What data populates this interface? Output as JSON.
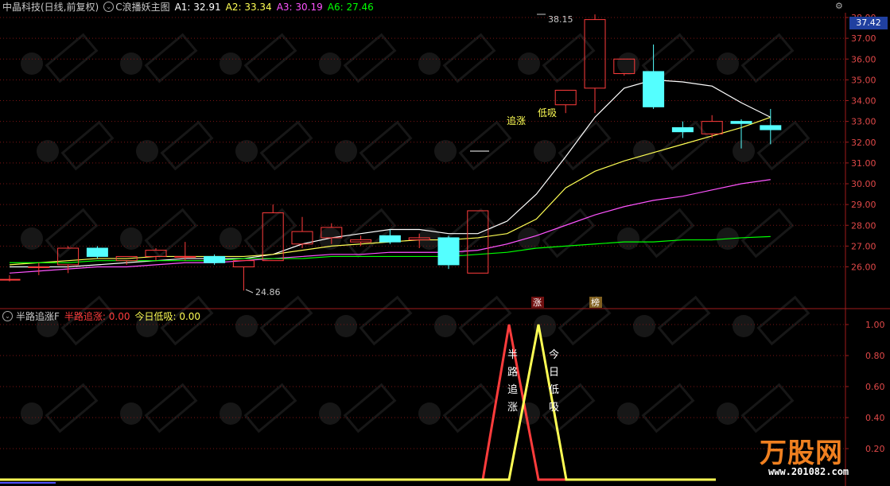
{
  "header": {
    "stock": "中晶科技(日线,前复权)",
    "indicator": "C浪播妖主图",
    "a1": "A1: 32.91",
    "a2": "A2: 33.34",
    "a3": "A3: 30.19",
    "a6": "A6: 27.46"
  },
  "sub_header": {
    "name": "半路追涨F",
    "v1": "半路追涨: 0.00",
    "v2": "今日低吸: 0.00"
  },
  "current_price": "37.42",
  "annotations": {
    "high": "38.15",
    "low": "24.86",
    "zhuizhang": "追涨",
    "dixi": "低吸",
    "tag_zhang": "涨",
    "tag_bang": "榜",
    "sub_label1": "半路追涨",
    "sub_label2": "今日低吸"
  },
  "watermark": {
    "logo": "万股网",
    "url": "www.201082.com"
  },
  "colors": {
    "up": "#ff3c3c",
    "down": "#54ffff",
    "a1": "#ffffff",
    "a2": "#ffff54",
    "a3": "#ff54ff",
    "a6": "#00ff00",
    "grid": "#7a1414"
  },
  "chart_data": [
    {
      "type": "candlestick",
      "title": "C浪播妖主图",
      "ylim": [
        25.3,
        38.5
      ],
      "yticks": [
        "38.00",
        "37.00",
        "36.00",
        "35.00",
        "34.00",
        "33.00",
        "32.00",
        "31.00",
        "30.00",
        "29.00",
        "28.00",
        "27.00",
        "26.00"
      ],
      "ohlc": [
        [
          25.4,
          25.6,
          25.3,
          25.4
        ],
        [
          26.0,
          26.2,
          25.6,
          26.0
        ],
        [
          26.1,
          27.0,
          25.7,
          26.9
        ],
        [
          26.9,
          27.0,
          26.4,
          26.5
        ],
        [
          26.3,
          26.5,
          26.1,
          26.5
        ],
        [
          26.5,
          26.9,
          26.3,
          26.8
        ],
        [
          26.5,
          27.2,
          26.3,
          26.5
        ],
        [
          26.5,
          26.6,
          26.1,
          26.2
        ],
        [
          26.0,
          26.3,
          24.86,
          26.3
        ],
        [
          26.3,
          29.0,
          26.3,
          28.6
        ],
        [
          27.1,
          28.4,
          26.9,
          27.7
        ],
        [
          27.4,
          28.1,
          27.1,
          27.9
        ],
        [
          27.2,
          27.5,
          27.0,
          27.3
        ],
        [
          27.5,
          27.8,
          27.1,
          27.2
        ],
        [
          27.3,
          27.6,
          26.9,
          27.4
        ],
        [
          27.4,
          27.5,
          25.9,
          26.1
        ],
        [
          25.7,
          28.7,
          25.7,
          28.7
        ],
        null,
        null,
        [
          33.8,
          34.5,
          33.4,
          34.5
        ],
        [
          34.6,
          38.15,
          33.4,
          37.9
        ],
        [
          35.3,
          36.0,
          35.2,
          36.0
        ],
        [
          35.4,
          36.7,
          33.6,
          33.7
        ],
        [
          32.7,
          33.0,
          32.2,
          32.5
        ],
        [
          32.4,
          33.3,
          32.2,
          33.0
        ],
        [
          33.0,
          33.1,
          31.7,
          32.9
        ],
        [
          32.8,
          33.6,
          31.9,
          32.6
        ]
      ],
      "series": [
        {
          "name": "A1",
          "values": [
            26.0,
            26.0,
            26.0,
            26.1,
            26.2,
            26.3,
            26.4,
            26.4,
            26.4,
            26.6,
            27.1,
            27.4,
            27.6,
            27.8,
            27.8,
            27.6,
            27.6,
            28.2,
            29.5,
            31.3,
            33.2,
            34.6,
            35.0,
            34.9,
            34.7,
            33.9,
            33.2
          ]
        },
        {
          "name": "A2",
          "values": [
            26.1,
            26.2,
            26.3,
            26.4,
            26.4,
            26.5,
            26.5,
            26.5,
            26.5,
            26.6,
            26.8,
            27.0,
            27.1,
            27.2,
            27.3,
            27.3,
            27.4,
            27.6,
            28.3,
            29.8,
            30.6,
            31.1,
            31.5,
            31.9,
            32.3,
            32.7,
            33.2
          ]
        },
        {
          "name": "A3",
          "values": [
            25.7,
            25.8,
            25.9,
            26.0,
            26.0,
            26.1,
            26.2,
            26.2,
            26.3,
            26.4,
            26.5,
            26.6,
            26.6,
            26.7,
            26.7,
            26.7,
            26.8,
            27.1,
            27.5,
            28.0,
            28.5,
            28.9,
            29.2,
            29.4,
            29.7,
            30.0,
            30.2
          ]
        },
        {
          "name": "A6",
          "values": [
            26.2,
            26.2,
            26.2,
            26.3,
            26.3,
            26.3,
            26.3,
            26.3,
            26.4,
            26.4,
            26.4,
            26.5,
            26.5,
            26.5,
            26.5,
            26.5,
            26.6,
            26.7,
            26.9,
            27.0,
            27.1,
            27.2,
            27.2,
            27.3,
            27.3,
            27.4,
            27.46
          ]
        }
      ]
    },
    {
      "type": "line",
      "title": "半路追涨F",
      "ylim": [
        0,
        1.1
      ],
      "yticks": [
        "1.00",
        "0.80",
        "0.60",
        "0.40",
        "0.20"
      ],
      "series": [
        {
          "name": "半路追涨",
          "x": [
            0,
            607,
            640,
            677,
            712,
            900
          ],
          "values": [
            0,
            0,
            1,
            0,
            0,
            0
          ]
        },
        {
          "name": "今日低吸",
          "x": [
            0,
            640,
            677,
            712,
            900
          ],
          "values": [
            0,
            0,
            1,
            0,
            0
          ]
        }
      ]
    }
  ]
}
